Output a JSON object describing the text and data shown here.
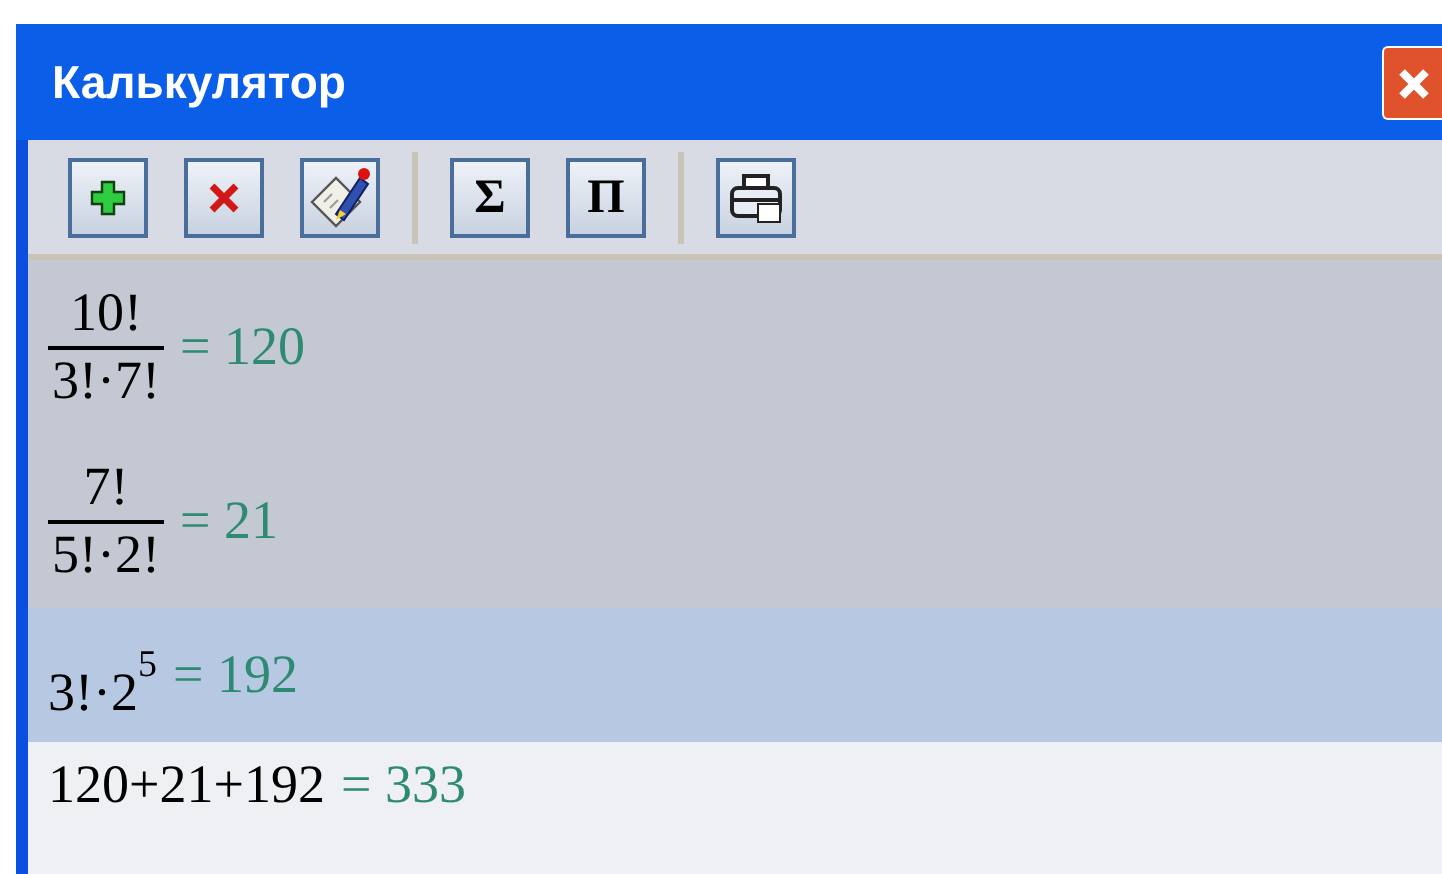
{
  "window": {
    "title": "Калькулятор"
  },
  "toolbar": [
    {
      "kind": "add"
    },
    {
      "kind": "delete"
    },
    {
      "kind": "edit"
    },
    {
      "kind": "separator"
    },
    {
      "kind": "glyph",
      "label": "Σ"
    },
    {
      "kind": "glyph",
      "label": "Π"
    },
    {
      "kind": "separator"
    },
    {
      "kind": "print"
    }
  ],
  "rows": [
    {
      "kind": "fraction",
      "numerator": "10!",
      "denominator": "3!·7!",
      "result": "= 120",
      "evaluated": true,
      "selected": false
    },
    {
      "kind": "fraction",
      "numerator": "7!",
      "denominator": "5!·2!",
      "result": "= 21",
      "evaluated": true,
      "selected": false
    },
    {
      "kind": "power",
      "base": "3!·2",
      "exponent": "5",
      "result": "= 192",
      "evaluated": false,
      "selected": true
    },
    {
      "kind": "plain",
      "text": "120+21+192",
      "result": "= 333",
      "evaluated": false,
      "selected": false
    }
  ]
}
